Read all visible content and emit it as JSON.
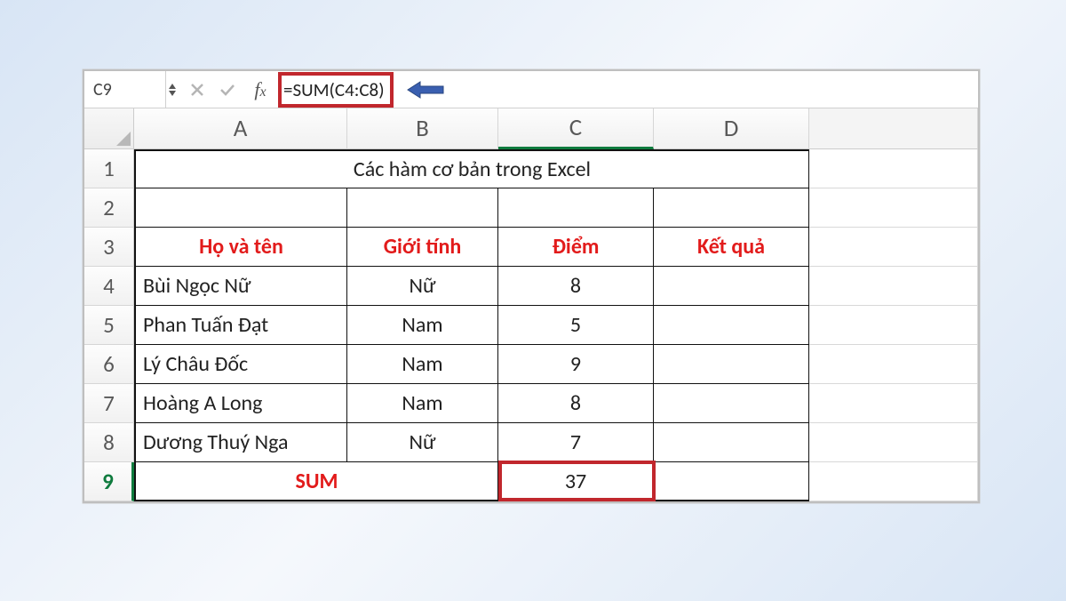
{
  "formula_bar": {
    "name_box": "C9",
    "formula": "=SUM(C4:C8)"
  },
  "columns": [
    "A",
    "B",
    "C",
    "D"
  ],
  "row_numbers": [
    "1",
    "2",
    "3",
    "4",
    "5",
    "6",
    "7",
    "8",
    "9"
  ],
  "title": "Các hàm cơ bản trong Excel",
  "headers": {
    "name": "Họ và tên",
    "gender": "Giới tính",
    "score": "Điểm",
    "result": "Kết quả"
  },
  "rows": [
    {
      "name": "Bùi Ngọc Nữ",
      "gender": "Nữ",
      "score": "8",
      "result": ""
    },
    {
      "name": "Phan Tuấn Đạt",
      "gender": "Nam",
      "score": "5",
      "result": ""
    },
    {
      "name": "Lý Châu Đốc",
      "gender": "Nam",
      "score": "9",
      "result": ""
    },
    {
      "name": "Hoàng A Long",
      "gender": "Nam",
      "score": "8",
      "result": ""
    },
    {
      "name": "Dương Thuý Nga",
      "gender": "Nữ",
      "score": "7",
      "result": ""
    }
  ],
  "sum_row": {
    "label": "SUM",
    "value": "37"
  },
  "active_cell": "C9",
  "highlight_color": "#c1272d"
}
